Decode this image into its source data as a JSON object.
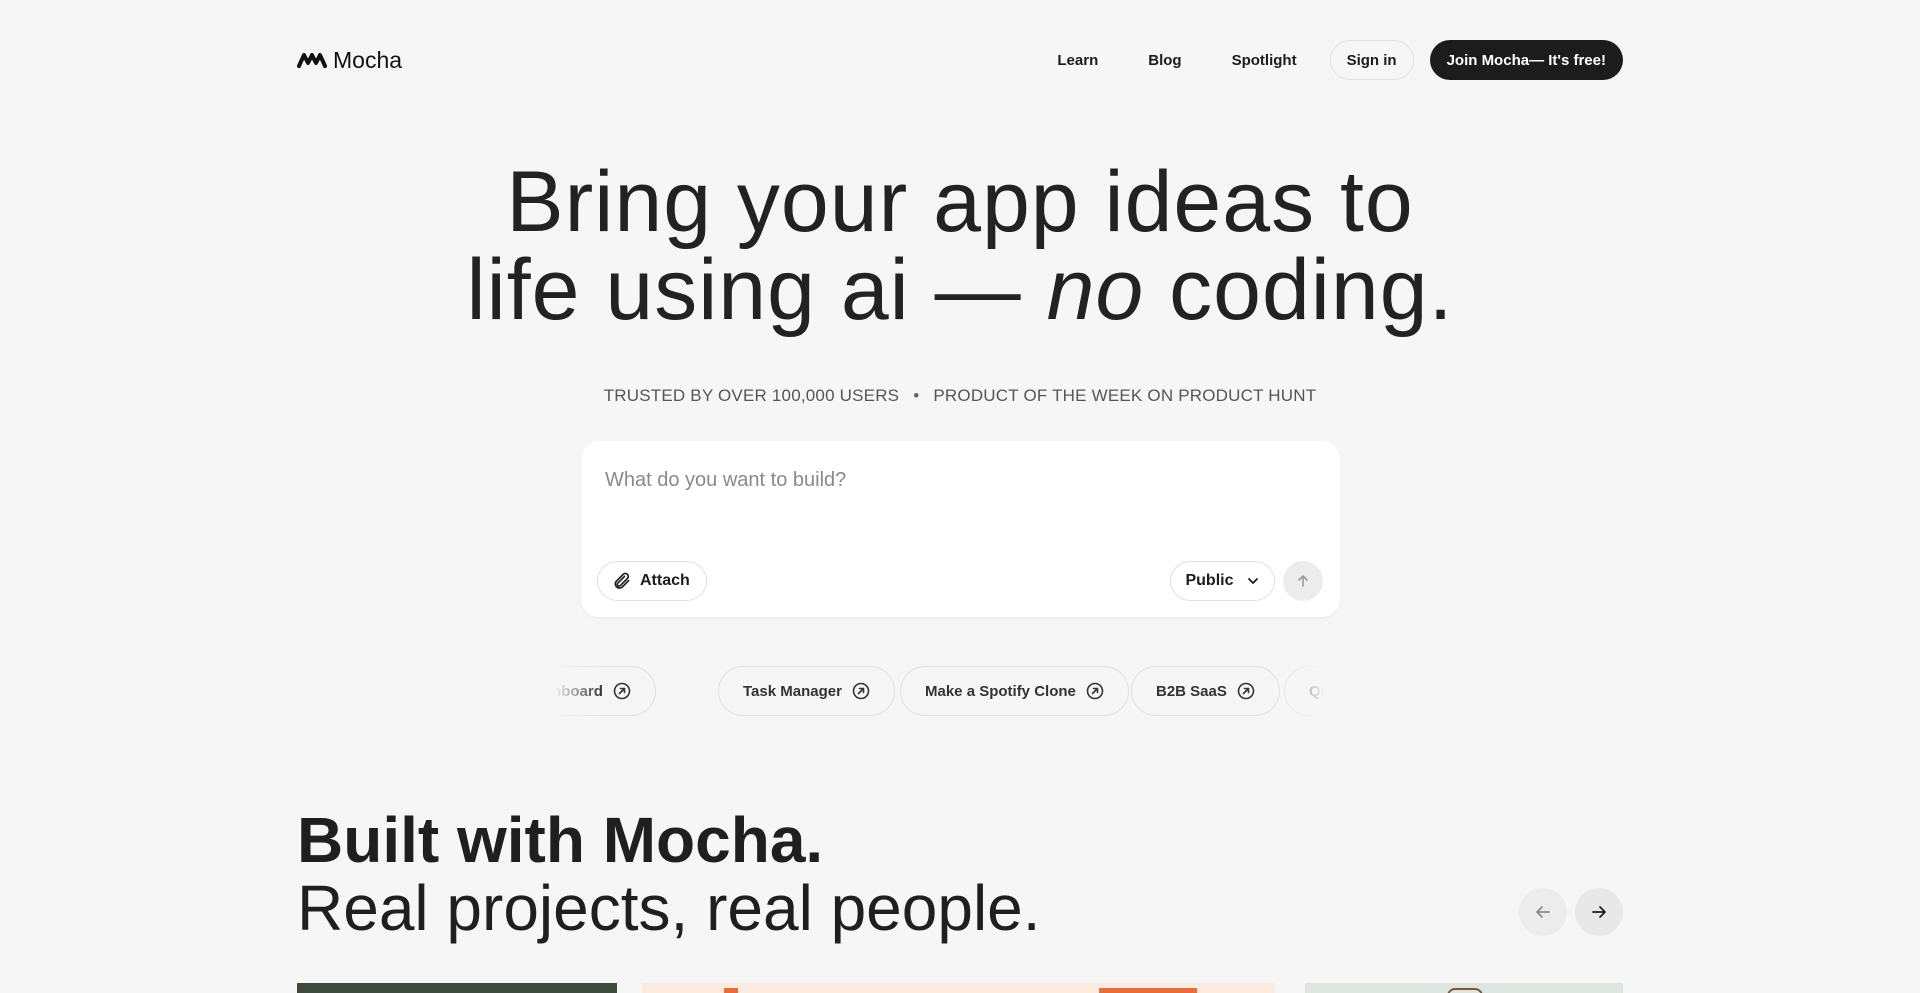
{
  "header": {
    "logo_text": "Mocha",
    "nav": [
      {
        "label": "Learn"
      },
      {
        "label": "Blog"
      },
      {
        "label": "Spotlight"
      }
    ],
    "signin_label": "Sign in",
    "join_label": "Join Mocha— It's free!"
  },
  "hero": {
    "line1": "Bring your app ideas to",
    "line2_start": "life using ai — ",
    "line2_em": "no",
    "line2_end": " coding."
  },
  "trust": {
    "users": "TRUSTED BY OVER 100,000 USERS",
    "separator": "•",
    "award": "PRODUCT OF THE WEEK ON PRODUCT HUNT"
  },
  "prompt": {
    "placeholder": "What do you want to build?",
    "value": "",
    "attach_label": "Attach",
    "visibility_selected": "Public"
  },
  "suggestions": [
    {
      "label": "Tracker Dashboard"
    },
    {
      "label": "Task Manager"
    },
    {
      "label": "Make a Spotify Clone"
    },
    {
      "label": "B2B SaaS"
    },
    {
      "label": "Quiz Generator"
    }
  ],
  "showcase": {
    "title_line1": "Built with Mocha.",
    "title_line2": "Real projects, real people."
  },
  "colors": {
    "background": "#f6f6f6",
    "primary_button": "#1c1c1c",
    "accent_orange": "#e76e3c"
  },
  "icons": {
    "logo": "mocha-logo-icon",
    "attach": "paperclip-icon",
    "dropdown": "chevron-down-icon",
    "send": "arrow-up-icon",
    "chip": "arrow-up-right-circle-icon",
    "prev": "arrow-left-icon",
    "next": "arrow-right-icon"
  }
}
